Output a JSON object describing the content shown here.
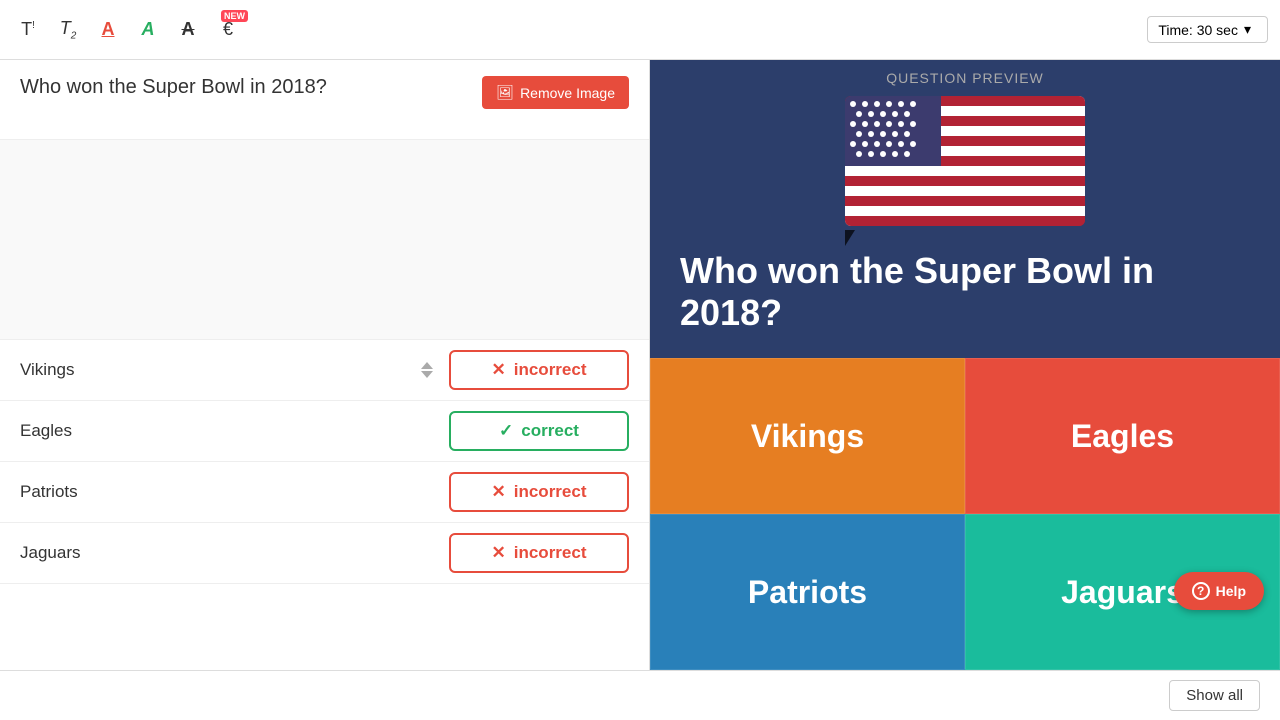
{
  "toolbar": {
    "icons": [
      {
        "name": "text-bold-icon",
        "symbol": "T",
        "superscript": "!"
      },
      {
        "name": "text-alt-icon",
        "symbol": "T₂"
      },
      {
        "name": "font-color-icon",
        "symbol": "A"
      },
      {
        "name": "font-highlight-icon",
        "symbol": "A"
      },
      {
        "name": "font-strikethrough-icon",
        "symbol": "A"
      },
      {
        "name": "currency-icon",
        "symbol": "€",
        "badge": "NEW"
      }
    ],
    "time_label": "Time: 30 sec",
    "chevron_symbol": "▾"
  },
  "editor": {
    "question": "Who won the Super Bowl in 2018?",
    "remove_image_label": "Remove Image",
    "answers": [
      {
        "id": 1,
        "label": "Vikings",
        "status": "incorrect",
        "status_type": "incorrect"
      },
      {
        "id": 2,
        "label": "Eagles",
        "status": "correct",
        "status_type": "correct"
      },
      {
        "id": 3,
        "label": "Patriots",
        "status": "incorrect",
        "status_type": "incorrect"
      },
      {
        "id": 4,
        "label": "Jaguars",
        "status": "incorrect",
        "status_type": "incorrect"
      }
    ]
  },
  "preview": {
    "header": "QUESTION PREVIEW",
    "question": "Who won the Super Bowl in 2018?",
    "answers": [
      {
        "label": "Vikings",
        "color_class": "orange"
      },
      {
        "label": "Eagles",
        "color_class": "red"
      },
      {
        "label": "Patriots",
        "color_class": "blue"
      },
      {
        "label": "Jaguars",
        "color_class": "teal"
      }
    ]
  },
  "bottom_bar": {
    "show_all_label": "Show all"
  },
  "help": {
    "label": "Help"
  },
  "icons": {
    "incorrect_symbol": "✕",
    "correct_symbol": "✓",
    "image_symbol": "🖼",
    "question_circle": "?"
  }
}
